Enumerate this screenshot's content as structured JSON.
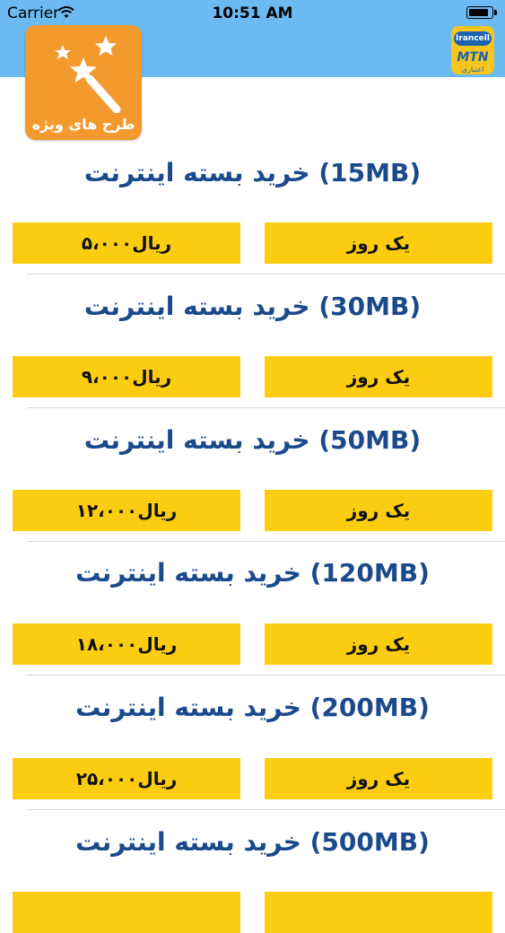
{
  "status_bar": {
    "carrier": "Carrier",
    "time": "10:51 AM",
    "battery_level": 1.0
  },
  "special_plans": {
    "label": "طرح های ویژه",
    "icon": "magic-wand-icon"
  },
  "logo": {
    "brand": "Irancell",
    "name": "MTN",
    "subtitle": "اعتباری"
  },
  "packages": [
    {
      "title": "خرید بسته اینترنت (15MB)",
      "price": "۵،۰۰۰ریال",
      "duration": "یک روز"
    },
    {
      "title": "خرید بسته اینترنت (30MB)",
      "price": "۹،۰۰۰ریال",
      "duration": "یک روز"
    },
    {
      "title": "خرید بسته اینترنت (50MB)",
      "price": "۱۲،۰۰۰ریال",
      "duration": "یک روز"
    },
    {
      "title": "خرید بسته اینترنت (120MB)",
      "price": "۱۸،۰۰۰ریال",
      "duration": "یک روز"
    },
    {
      "title": "خرید بسته اینترنت (200MB)",
      "price": "۲۵،۰۰۰ریال",
      "duration": "یک روز"
    },
    {
      "title": "خرید بسته اینترنت (500MB)",
      "price": "",
      "duration": ""
    }
  ],
  "colors": {
    "header_bg": "#6cbaf2",
    "accent_orange": "#f29a2e",
    "button_yellow": "#fccc10",
    "title_blue": "#1b4a8c"
  }
}
